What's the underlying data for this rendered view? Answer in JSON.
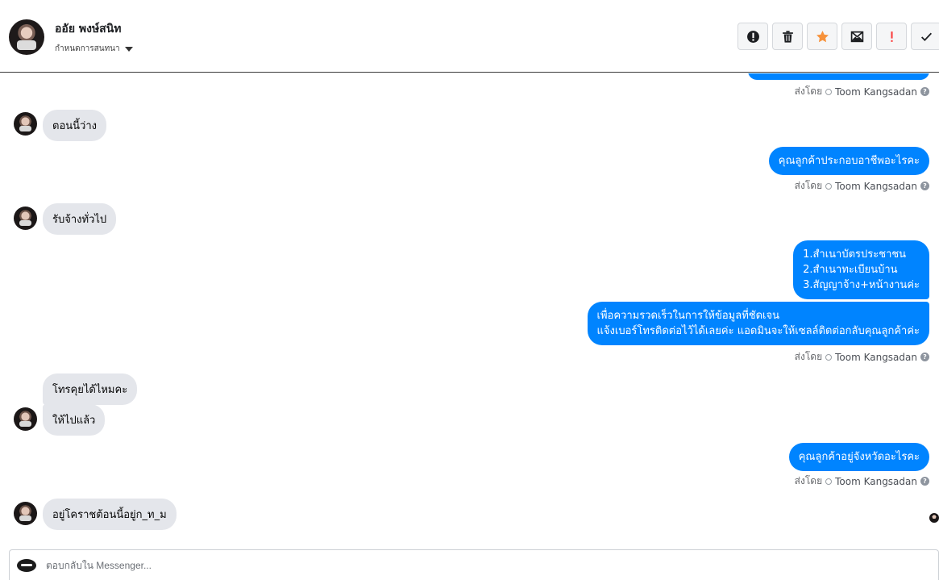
{
  "header": {
    "contact_name": "ออัย พงษ์สนิท",
    "assign_label": "กำหนดการสนทนา",
    "actions": [
      {
        "name": "spam-button",
        "icon": "alert-circle-icon",
        "color": "#1c1e21"
      },
      {
        "name": "delete-button",
        "icon": "trash-icon",
        "color": "#1c1e21"
      },
      {
        "name": "star-button",
        "icon": "star-icon",
        "color": "#f7923b"
      },
      {
        "name": "mark-unread-button",
        "icon": "envelope-icon",
        "color": "#1c1e21"
      },
      {
        "name": "follow-up-button",
        "icon": "exclamation-icon",
        "color": "#fa3e3e"
      },
      {
        "name": "done-button",
        "icon": "check-icon",
        "color": "#1c1e21"
      }
    ]
  },
  "sent_by_label": "ส่งโดย",
  "agent_name": "Toom Kangsadan",
  "messages": {
    "in_1": "ตอนนี้ว่าง",
    "out_1": "คุณลูกค้าประกอบอาชีพอะไรคะ",
    "in_2": "รับจ้างทั่วไป",
    "out_2_lines": [
      "1.สำเนาบัตรประชาชน",
      "2.สำเนาทะเบียนบ้าน",
      "3.สัญญาจ้าง+หน้างานค่ะ"
    ],
    "out_3_lines": [
      "เพื่อความรวดเร็วในการให้ข้อมูลที่ชัดเจน",
      "แจ้งเบอร์โทรติดต่อไว้ได้เลยค่ะ แอดมินจะให้เซลล์ติดต่อกลับคุณลูกค้าค่ะ"
    ],
    "in_3": "โทรคุยได้ไหมคะ",
    "in_4": "ให้ไปแล้ว",
    "out_4": "คุณลูกค้าอยู่จังหวัดอะไรคะ",
    "in_5": "อยู่โคราชต้อนนี้อยู่ก_ท_ม"
  },
  "composer": {
    "placeholder": "ตอบกลับใน Messenger..."
  },
  "colors": {
    "outgoing_bubble": "#0084ff",
    "incoming_bubble": "#e4e6eb"
  }
}
